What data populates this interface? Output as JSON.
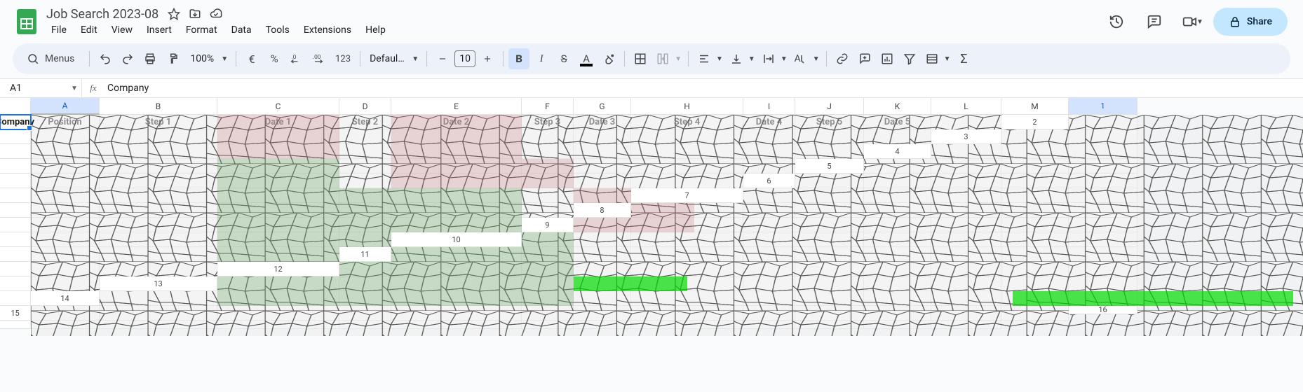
{
  "document": {
    "title": "Job Search 2023-08",
    "menus_label": "Menus",
    "zoom": "100%",
    "font_family": "Default…",
    "font_size": "10"
  },
  "menus": {
    "file": "File",
    "edit": "Edit",
    "view": "View",
    "insert": "Insert",
    "format": "Format",
    "data": "Data",
    "tools": "Tools",
    "extensions": "Extensions",
    "help": "Help"
  },
  "toolbar": {
    "percent_label": "%",
    "format123_label": "123"
  },
  "share": {
    "label": "Share"
  },
  "name_box": {
    "value": "A1"
  },
  "formula_bar": {
    "value": "Company"
  },
  "columns": [
    "A",
    "B",
    "C",
    "D",
    "E",
    "F",
    "G",
    "H",
    "I",
    "J",
    "K",
    "L",
    "M"
  ],
  "headers": {
    "A": "Company",
    "B": "Position",
    "C": "Step 1",
    "D": "Date 1",
    "E": "Step 2",
    "F": "Date 2",
    "G": "Step 3",
    "H": "Date 3",
    "I": "Step 4",
    "J": "Date 4",
    "K": "Step 5",
    "L": "Date 5",
    "M": ""
  },
  "row_numbers": [
    "1",
    "2",
    "3",
    "4",
    "5",
    "6",
    "7",
    "8",
    "9",
    "10",
    "11",
    "12",
    "13",
    "14",
    "15",
    "16"
  ]
}
